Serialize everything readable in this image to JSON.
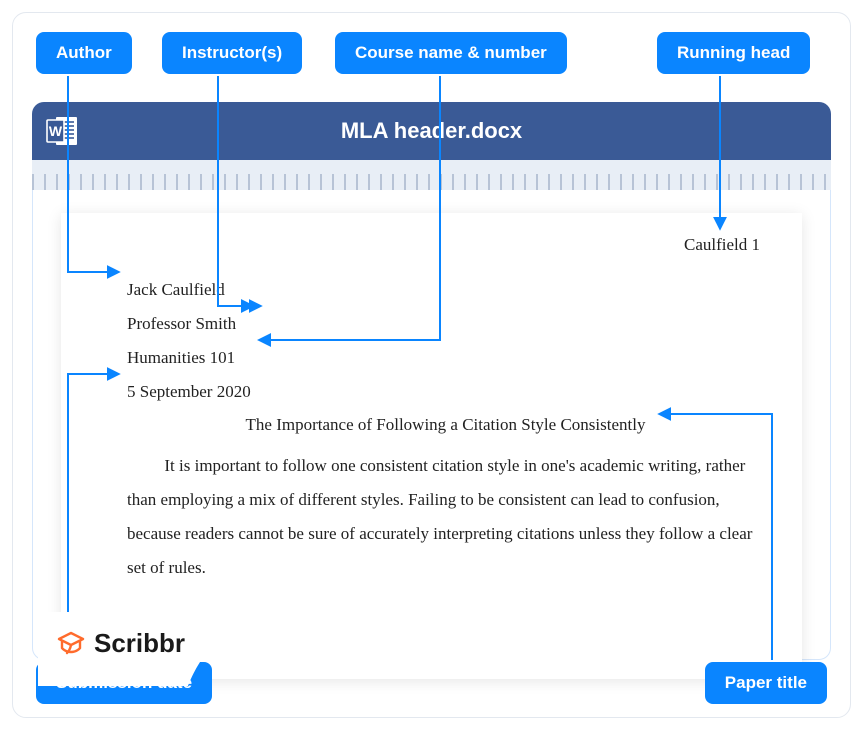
{
  "badges": {
    "author": "Author",
    "instructor": "Instructor(s)",
    "course": "Course name & number",
    "running_head": "Running head",
    "submission_date": "Submission date",
    "paper_title": "Paper title"
  },
  "document": {
    "filename": "MLA header.docx",
    "running_head": "Caulfield 1",
    "author": "Jack Caulfield",
    "instructor": "Professor Smith",
    "course": "Humanities 101",
    "date": "5 September 2020",
    "title": "The Importance of Following a Citation Style Consistently",
    "body": "It is important to follow one consistent citation style in one's academic writing, rather than employing a mix of different styles. Failing to be consistent can lead to confusion, because readers cannot be sure of accurately interpreting citations unless they follow a clear set of rules."
  },
  "logo": {
    "name": "Scribbr"
  },
  "colors": {
    "accent": "#0a85ff",
    "titlebar": "#3a5a96",
    "logo_orange": "#ff6b2c"
  }
}
